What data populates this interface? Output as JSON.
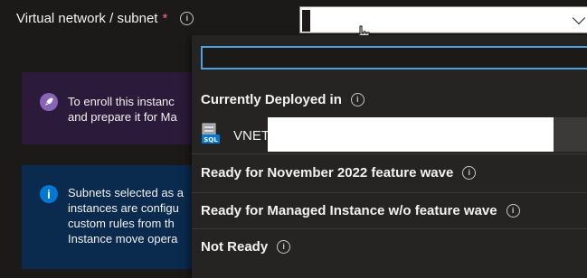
{
  "field": {
    "label": "Virtual network / subnet",
    "required_mark": "*",
    "info_glyph": "i"
  },
  "banners": {
    "enroll": {
      "icon": "rocket-icon",
      "lines": [
        "To enroll this instanc",
        "and prepare it for Ma"
      ]
    },
    "subnets": {
      "icon": "info-icon",
      "icon_glyph": "i",
      "lines": [
        "Subnets selected as a",
        "instances are configu",
        "custom rules from th",
        "Instance move opera"
      ]
    }
  },
  "dropdown": {
    "search": {
      "value": "",
      "placeholder": ""
    },
    "groups": {
      "deployed": "Currently Deployed in",
      "nov2022": "Ready for November 2022 feature wave",
      "managed": "Ready for Managed Instance w/o feature wave",
      "notready": "Not Ready"
    },
    "option": {
      "label": "VNET",
      "icon": "sql-database-icon",
      "icon_text": "SQL"
    }
  },
  "colors": {
    "page_bg": "#1b1a19",
    "dropdown_bg": "#252423",
    "focus_border": "#4f9fe0",
    "required": "#f1707b",
    "purple_banner": "#2b1a3a",
    "blue_banner": "#0a2a4e",
    "info_accent": "#0078d4"
  }
}
